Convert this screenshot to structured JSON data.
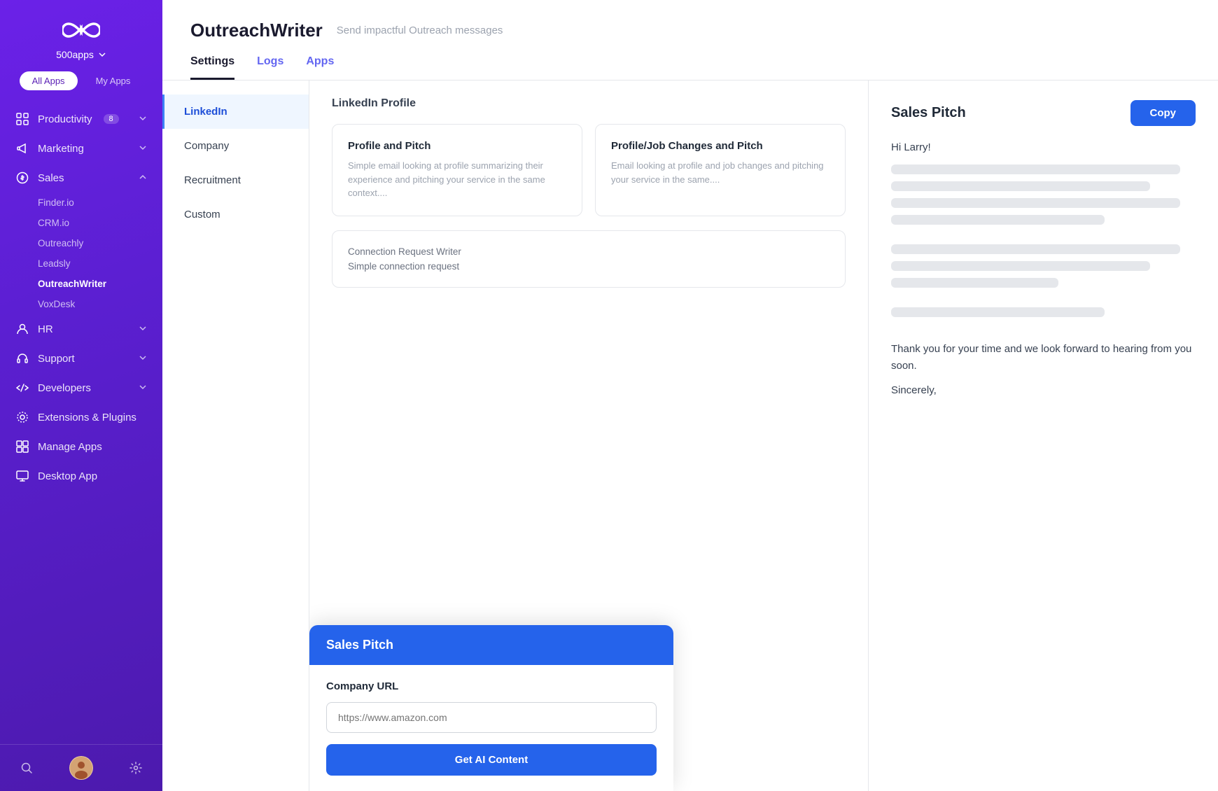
{
  "sidebar": {
    "logo_brand": "500apps",
    "tabs": [
      {
        "label": "All Apps",
        "active": true
      },
      {
        "label": "My Apps",
        "active": false
      }
    ],
    "nav_items": [
      {
        "label": "Productivity",
        "icon": "grid",
        "has_chevron": true,
        "badge": "8"
      },
      {
        "label": "Marketing",
        "icon": "megaphone",
        "has_chevron": true
      },
      {
        "label": "Sales",
        "icon": "dollar",
        "has_chevron": true,
        "expanded": true
      },
      {
        "sub_items": [
          {
            "label": "Finder.io",
            "active": false
          },
          {
            "label": "CRM.io",
            "active": false
          },
          {
            "label": "Outreachly",
            "active": false
          },
          {
            "label": "Leadsly",
            "active": false
          },
          {
            "label": "OutreachWriter",
            "active": true
          },
          {
            "label": "VoxDesk",
            "active": false
          }
        ]
      },
      {
        "label": "HR",
        "icon": "person",
        "has_chevron": true
      },
      {
        "label": "Support",
        "icon": "headset",
        "has_chevron": true
      },
      {
        "label": "Developers",
        "icon": "code",
        "has_chevron": true
      },
      {
        "label": "Extensions & Plugins",
        "icon": "puzzle",
        "has_chevron": false
      },
      {
        "label": "Manage Apps",
        "icon": "apps",
        "has_chevron": false
      },
      {
        "label": "Desktop App",
        "icon": "monitor",
        "has_chevron": false
      }
    ]
  },
  "header": {
    "app_title": "OutreachWriter",
    "app_subtitle": "Send impactful Outreach messages",
    "tabs": [
      {
        "label": "Settings",
        "active": true
      },
      {
        "label": "Logs",
        "active": false
      },
      {
        "label": "Apps",
        "active": false
      }
    ]
  },
  "sub_nav": {
    "items": [
      {
        "label": "LinkedIn",
        "active": true
      },
      {
        "label": "Company",
        "active": false
      },
      {
        "label": "Recruitment",
        "active": false
      },
      {
        "label": "Custom",
        "active": false
      }
    ]
  },
  "linkedin_section": {
    "profile_label": "LinkedIn Profile",
    "cards": [
      {
        "title": "Profile and Pitch",
        "description": "Simple email looking at profile summarizing their experience and pitching your service in the same context...."
      },
      {
        "title": "Profile/Job Changes and Pitch",
        "description": "Email looking at profile and job changes and pitching your service in the same...."
      }
    ],
    "connection_card": {
      "section_label": "Connection Request Writer",
      "sub_label": "Simple connection request"
    }
  },
  "sales_pitch_popup": {
    "title": "Sales Pitch",
    "company_url_label": "Company URL",
    "company_url_placeholder": "https://www.amazon.com",
    "get_ai_btn": "Get AI Content"
  },
  "generated_panel": {
    "title": "Sales Pitch",
    "copy_btn": "Copy",
    "greeting": "Hi Larry!",
    "closing": "Thank you for your time and we look forward to hearing from you soon.",
    "sincerely": "Sincerely,"
  }
}
